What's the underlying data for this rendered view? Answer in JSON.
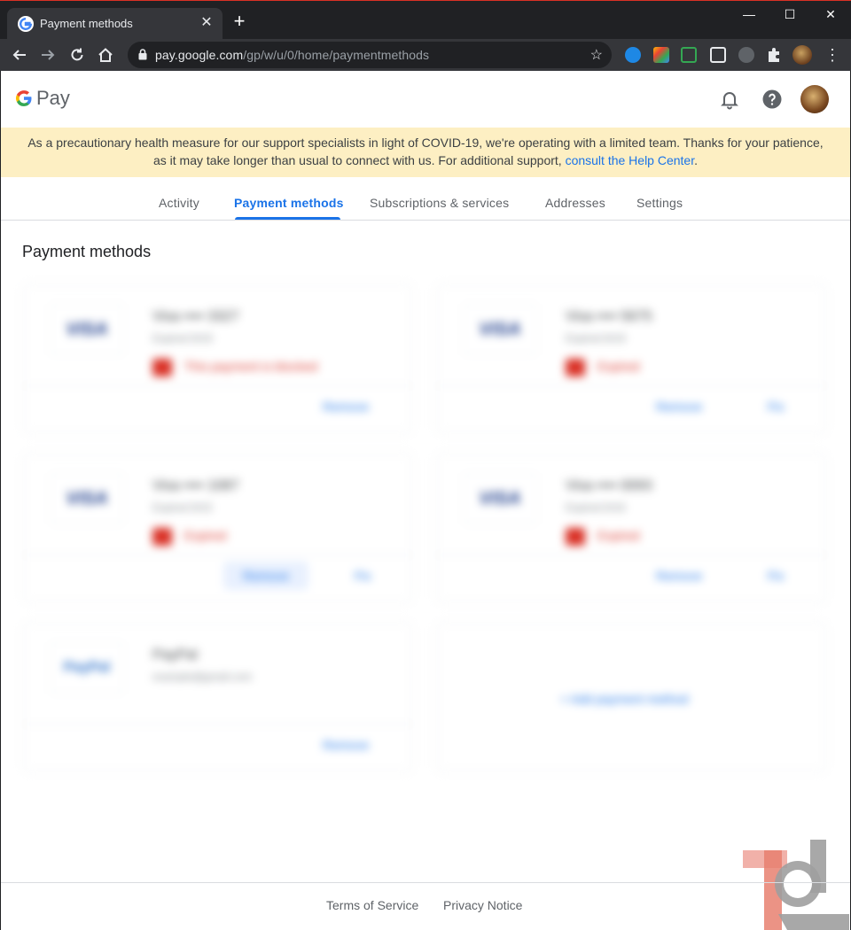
{
  "browser": {
    "tab_title": "Payment methods",
    "tab_close": "✕",
    "new_tab": "+",
    "url_host": "pay.google.com",
    "url_path": "/gp/w/u/0/home/paymentmethods",
    "controls": {
      "minimize": "—",
      "maximize": "☐",
      "close": "✕"
    }
  },
  "header": {
    "logo_g": "G",
    "logo_pay": "Pay",
    "icons": [
      "bell-icon",
      "help-icon",
      "avatar"
    ]
  },
  "banner": {
    "text_line1": "As a precautionary health measure for our support specialists in light of COVID-19, we're operating with a limited team. Thanks for your patience,",
    "text_line2": "as it may take longer than usual to connect with us. For additional support,",
    "link": "consult the Help Center",
    "period": "."
  },
  "nav": {
    "tabs": [
      "Activity",
      "Payment methods",
      "Subscriptions & services",
      "Addresses",
      "Settings"
    ],
    "active": "Payment methods"
  },
  "main": {
    "title": "Payment methods",
    "cards": [
      {
        "logo": "VISA",
        "name": "Visa •••• 3327",
        "sub": "Expired 9/19",
        "status": "This payment is blocked",
        "actions": [
          "Remove"
        ]
      },
      {
        "logo": "VISA",
        "name": "Visa •••• 5675",
        "sub": "Expired 8/19",
        "status": "Expired",
        "actions": [
          "Remove",
          "Fix"
        ]
      },
      {
        "logo": "VISA",
        "name": "Visa •••• 1087",
        "sub": "Expired 9/15",
        "status": "Expired",
        "actions": [
          "Remove",
          "Fix"
        ]
      },
      {
        "logo": "VISA",
        "name": "Visa •••• 0093",
        "sub": "Expired 6/16",
        "status": "Expired",
        "actions": [
          "Remove",
          "Fix"
        ]
      },
      {
        "logo": "PayPal",
        "name": "PayPal",
        "sub": "example@gmail.com",
        "status": "",
        "actions": [
          "Remove"
        ]
      }
    ],
    "add_payment": "+ Add payment method"
  },
  "footer": {
    "terms": "Terms of Service",
    "privacy": "Privacy Notice"
  },
  "colors": {
    "accent": "#1a73e8",
    "error": "#d93025",
    "banner_bg": "#fdefc3"
  }
}
